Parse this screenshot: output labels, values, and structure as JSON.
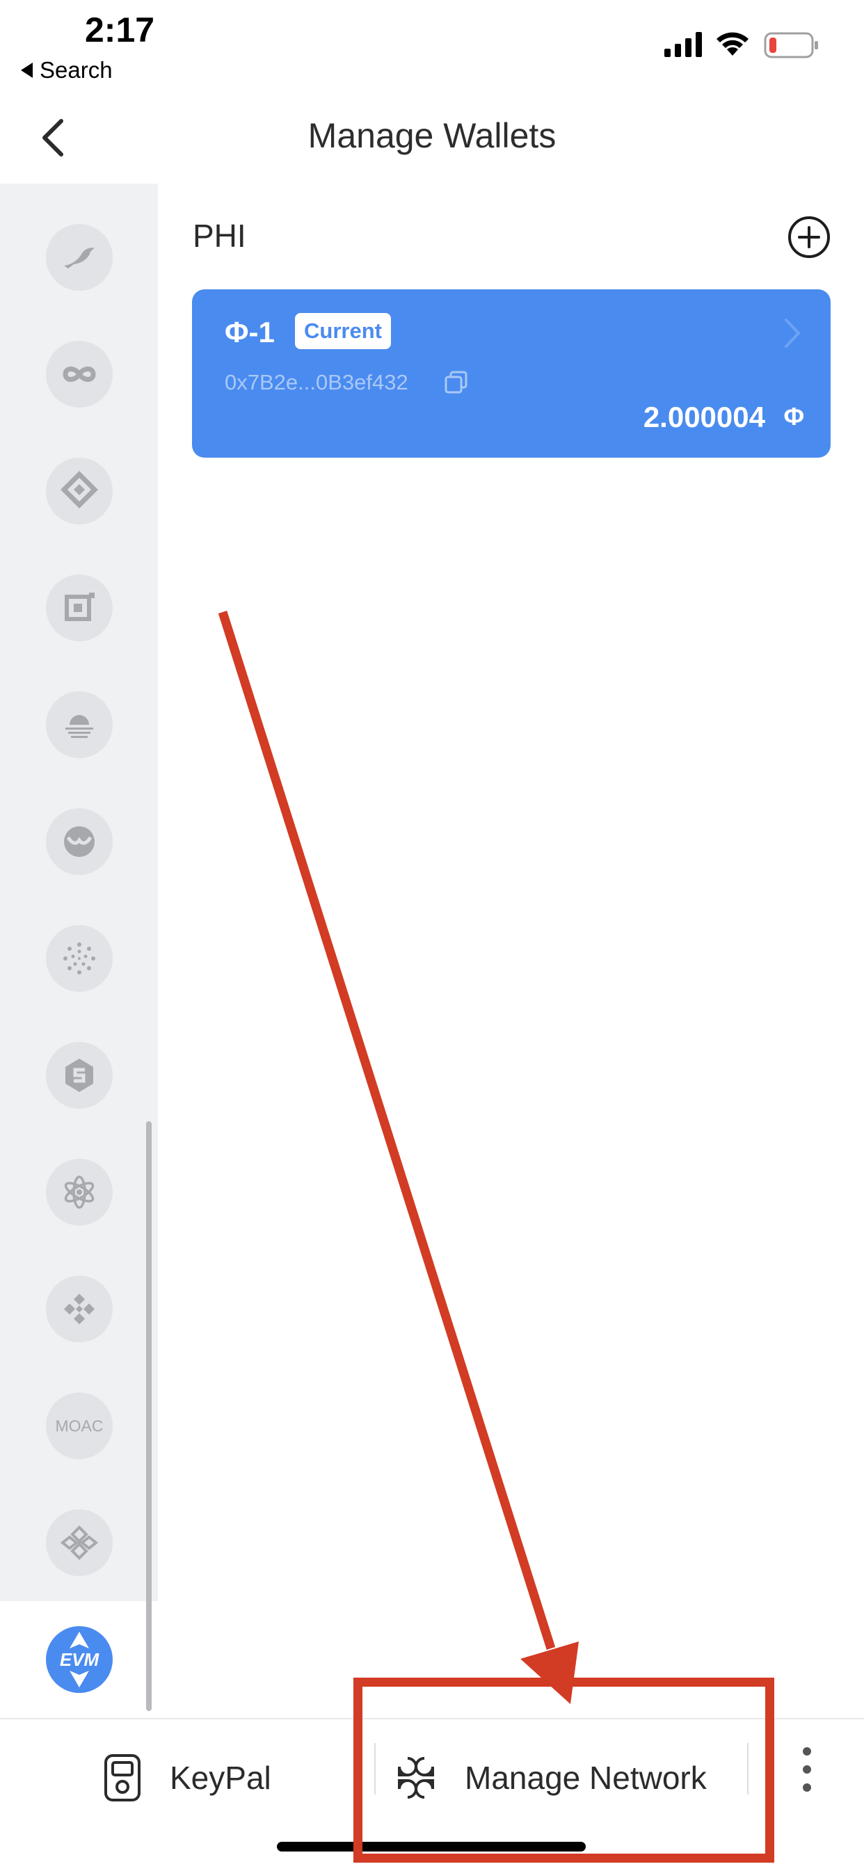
{
  "status_bar": {
    "time": "2:17",
    "back_app_label": "Search",
    "signal_icon": "cellular-signal-icon",
    "wifi_icon": "wifi-icon",
    "battery_icon": "battery-low-icon",
    "battery_color": "#e8453c"
  },
  "nav": {
    "title": "Manage Wallets",
    "back_icon": "chevron-left-icon"
  },
  "sidebar": {
    "coins": [
      {
        "icon": "bird-coin-icon"
      },
      {
        "icon": "infinity-coin-icon"
      },
      {
        "icon": "diamond-coin-icon"
      },
      {
        "icon": "square-frame-coin-icon"
      },
      {
        "icon": "sunset-coin-icon"
      },
      {
        "icon": "owl-coin-icon"
      },
      {
        "icon": "dotted-spiral-coin-icon"
      },
      {
        "icon": "hexagon-s-coin-icon"
      },
      {
        "icon": "atom-coin-icon"
      },
      {
        "icon": "binance-coin-icon"
      },
      {
        "label": "MOAC"
      },
      {
        "icon": "knot-coin-icon"
      },
      {
        "label": "EVM",
        "active": true
      }
    ]
  },
  "main": {
    "chain_name": "PHI",
    "add_icon": "plus-circle-icon",
    "wallets": [
      {
        "name": "Φ-1",
        "badge": "Current",
        "address": "0x7B2e...0B3ef432",
        "balance": "2.000004",
        "unit": "Φ",
        "card_color": "#4a8bef"
      }
    ]
  },
  "bottom_bar": {
    "keypal_label": "KeyPal",
    "manage_network_label": "Manage Network",
    "more_icon": "more-vertical-icon"
  },
  "annotation": {
    "color": "#d23b24"
  }
}
